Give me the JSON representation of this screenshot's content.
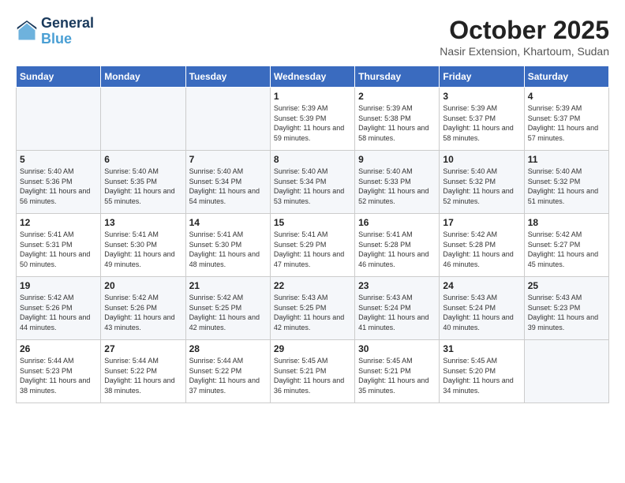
{
  "header": {
    "logo_line1": "General",
    "logo_line2": "Blue",
    "month": "October 2025",
    "location": "Nasir Extension, Khartoum, Sudan"
  },
  "weekdays": [
    "Sunday",
    "Monday",
    "Tuesday",
    "Wednesday",
    "Thursday",
    "Friday",
    "Saturday"
  ],
  "weeks": [
    [
      {
        "day": "",
        "info": ""
      },
      {
        "day": "",
        "info": ""
      },
      {
        "day": "",
        "info": ""
      },
      {
        "day": "1",
        "info": "Sunrise: 5:39 AM\nSunset: 5:39 PM\nDaylight: 11 hours and 59 minutes."
      },
      {
        "day": "2",
        "info": "Sunrise: 5:39 AM\nSunset: 5:38 PM\nDaylight: 11 hours and 58 minutes."
      },
      {
        "day": "3",
        "info": "Sunrise: 5:39 AM\nSunset: 5:37 PM\nDaylight: 11 hours and 58 minutes."
      },
      {
        "day": "4",
        "info": "Sunrise: 5:39 AM\nSunset: 5:37 PM\nDaylight: 11 hours and 57 minutes."
      }
    ],
    [
      {
        "day": "5",
        "info": "Sunrise: 5:40 AM\nSunset: 5:36 PM\nDaylight: 11 hours and 56 minutes."
      },
      {
        "day": "6",
        "info": "Sunrise: 5:40 AM\nSunset: 5:35 PM\nDaylight: 11 hours and 55 minutes."
      },
      {
        "day": "7",
        "info": "Sunrise: 5:40 AM\nSunset: 5:34 PM\nDaylight: 11 hours and 54 minutes."
      },
      {
        "day": "8",
        "info": "Sunrise: 5:40 AM\nSunset: 5:34 PM\nDaylight: 11 hours and 53 minutes."
      },
      {
        "day": "9",
        "info": "Sunrise: 5:40 AM\nSunset: 5:33 PM\nDaylight: 11 hours and 52 minutes."
      },
      {
        "day": "10",
        "info": "Sunrise: 5:40 AM\nSunset: 5:32 PM\nDaylight: 11 hours and 52 minutes."
      },
      {
        "day": "11",
        "info": "Sunrise: 5:40 AM\nSunset: 5:32 PM\nDaylight: 11 hours and 51 minutes."
      }
    ],
    [
      {
        "day": "12",
        "info": "Sunrise: 5:41 AM\nSunset: 5:31 PM\nDaylight: 11 hours and 50 minutes."
      },
      {
        "day": "13",
        "info": "Sunrise: 5:41 AM\nSunset: 5:30 PM\nDaylight: 11 hours and 49 minutes."
      },
      {
        "day": "14",
        "info": "Sunrise: 5:41 AM\nSunset: 5:30 PM\nDaylight: 11 hours and 48 minutes."
      },
      {
        "day": "15",
        "info": "Sunrise: 5:41 AM\nSunset: 5:29 PM\nDaylight: 11 hours and 47 minutes."
      },
      {
        "day": "16",
        "info": "Sunrise: 5:41 AM\nSunset: 5:28 PM\nDaylight: 11 hours and 46 minutes."
      },
      {
        "day": "17",
        "info": "Sunrise: 5:42 AM\nSunset: 5:28 PM\nDaylight: 11 hours and 46 minutes."
      },
      {
        "day": "18",
        "info": "Sunrise: 5:42 AM\nSunset: 5:27 PM\nDaylight: 11 hours and 45 minutes."
      }
    ],
    [
      {
        "day": "19",
        "info": "Sunrise: 5:42 AM\nSunset: 5:26 PM\nDaylight: 11 hours and 44 minutes."
      },
      {
        "day": "20",
        "info": "Sunrise: 5:42 AM\nSunset: 5:26 PM\nDaylight: 11 hours and 43 minutes."
      },
      {
        "day": "21",
        "info": "Sunrise: 5:42 AM\nSunset: 5:25 PM\nDaylight: 11 hours and 42 minutes."
      },
      {
        "day": "22",
        "info": "Sunrise: 5:43 AM\nSunset: 5:25 PM\nDaylight: 11 hours and 42 minutes."
      },
      {
        "day": "23",
        "info": "Sunrise: 5:43 AM\nSunset: 5:24 PM\nDaylight: 11 hours and 41 minutes."
      },
      {
        "day": "24",
        "info": "Sunrise: 5:43 AM\nSunset: 5:24 PM\nDaylight: 11 hours and 40 minutes."
      },
      {
        "day": "25",
        "info": "Sunrise: 5:43 AM\nSunset: 5:23 PM\nDaylight: 11 hours and 39 minutes."
      }
    ],
    [
      {
        "day": "26",
        "info": "Sunrise: 5:44 AM\nSunset: 5:23 PM\nDaylight: 11 hours and 38 minutes."
      },
      {
        "day": "27",
        "info": "Sunrise: 5:44 AM\nSunset: 5:22 PM\nDaylight: 11 hours and 38 minutes."
      },
      {
        "day": "28",
        "info": "Sunrise: 5:44 AM\nSunset: 5:22 PM\nDaylight: 11 hours and 37 minutes."
      },
      {
        "day": "29",
        "info": "Sunrise: 5:45 AM\nSunset: 5:21 PM\nDaylight: 11 hours and 36 minutes."
      },
      {
        "day": "30",
        "info": "Sunrise: 5:45 AM\nSunset: 5:21 PM\nDaylight: 11 hours and 35 minutes."
      },
      {
        "day": "31",
        "info": "Sunrise: 5:45 AM\nSunset: 5:20 PM\nDaylight: 11 hours and 34 minutes."
      },
      {
        "day": "",
        "info": ""
      }
    ]
  ]
}
